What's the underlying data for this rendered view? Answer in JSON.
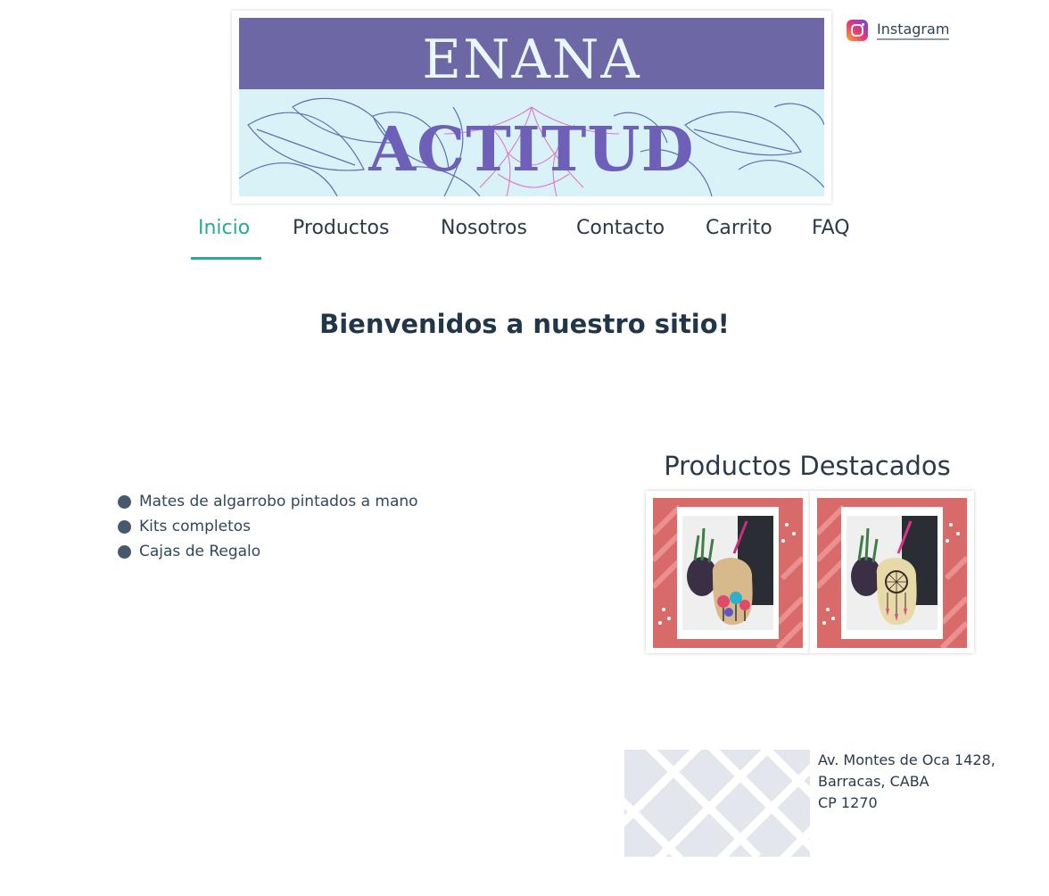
{
  "banner": {
    "title_line1": "ENANA",
    "title_line2": "ACTITUD"
  },
  "social": {
    "instagram_label": "Instagram",
    "icon": "instagram-icon"
  },
  "nav": {
    "items": [
      {
        "label": "Inicio",
        "active": true
      },
      {
        "label": "Productos",
        "active": false
      },
      {
        "label": "Nosotros",
        "active": false
      },
      {
        "label": "Contacto",
        "active": false
      },
      {
        "label": "Carrito",
        "active": false
      },
      {
        "label": "FAQ",
        "active": false
      }
    ]
  },
  "main": {
    "welcome": "Bienvenidos a nuestro sitio!",
    "features": [
      "Mates de algarrobo pintados a mano",
      "Kits completos",
      "Cajas de Regalo"
    ]
  },
  "featured": {
    "title": "Productos Destacados",
    "products": [
      {
        "name": "mate-flores"
      },
      {
        "name": "mate-atrapasuenos"
      }
    ]
  },
  "address": {
    "line1": "Av. Montes de Oca 1428,",
    "line2": "Barracas, CABA",
    "line3": "CP 1270"
  },
  "colors": {
    "accent": "#27a99b",
    "banner_purple": "#6e67a6",
    "title_purple": "#6e5fb8",
    "card_pink": "#d96a6a",
    "text": "#2b3a4a"
  }
}
